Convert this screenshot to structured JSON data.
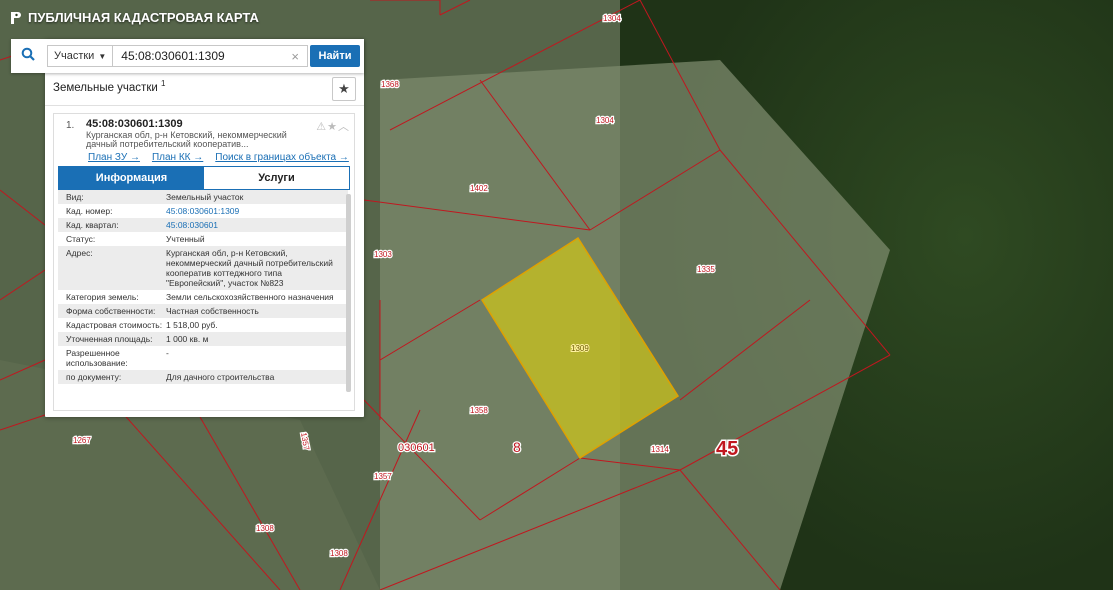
{
  "header": {
    "title": "ПУБЛИЧНАЯ КАДАСТРОВАЯ КАРТА"
  },
  "search": {
    "type_label": "Участки",
    "query": "45:08:030601:1309",
    "button": "Найти"
  },
  "results": {
    "title": "Земельные участки",
    "count": "1",
    "item": {
      "index": "1.",
      "cad_number": "45:08:030601:1309",
      "address_short": "Курганская обл, р-н Кетовский, некоммерческий дачный потребительский кооператив...",
      "links": [
        "План ЗУ →",
        "План КК →",
        "Поиск в границах объекта →"
      ]
    },
    "tabs": [
      "Информация",
      "Услуги"
    ],
    "attributes": [
      {
        "key": "Вид:",
        "value": "Земельный участок"
      },
      {
        "key": "Кад. номер:",
        "value": "45:08:030601:1309"
      },
      {
        "key": "Кад. квартал:",
        "value": "45:08:030601"
      },
      {
        "key": "Статус:",
        "value": "Учтенный"
      },
      {
        "key": "Адрес:",
        "value": "Курганская обл, р-н Кетовский, некоммерческий дачный потребительский кооператив коттеджного типа \"Европейский\", участок №823"
      },
      {
        "key": "Категория земель:",
        "value": "Земли сельскохозяйственного назначения"
      },
      {
        "key": "Форма собственности:",
        "value": "Частная собственность"
      },
      {
        "key": "Кадастровая стоимость:",
        "value": "1 518,00 руб."
      },
      {
        "key": "Уточненная площадь:",
        "value": "1 000 кв. м"
      },
      {
        "key": "Разрешенное использование:",
        "value": "-"
      },
      {
        "key": "по документу:",
        "value": "Для дачного строительства"
      }
    ]
  },
  "map": {
    "parcel_labels": [
      "1304",
      "1368",
      "1304",
      "1402",
      "1303",
      "1335",
      "1309",
      "1358",
      "1314",
      "1267",
      "1357",
      "1357",
      "1308",
      "1308"
    ],
    "quarter_label": "030601",
    "district_label": "8",
    "region_label": "45",
    "boundary_color": "#c0171f",
    "highlight_color": "#cdc51a"
  }
}
